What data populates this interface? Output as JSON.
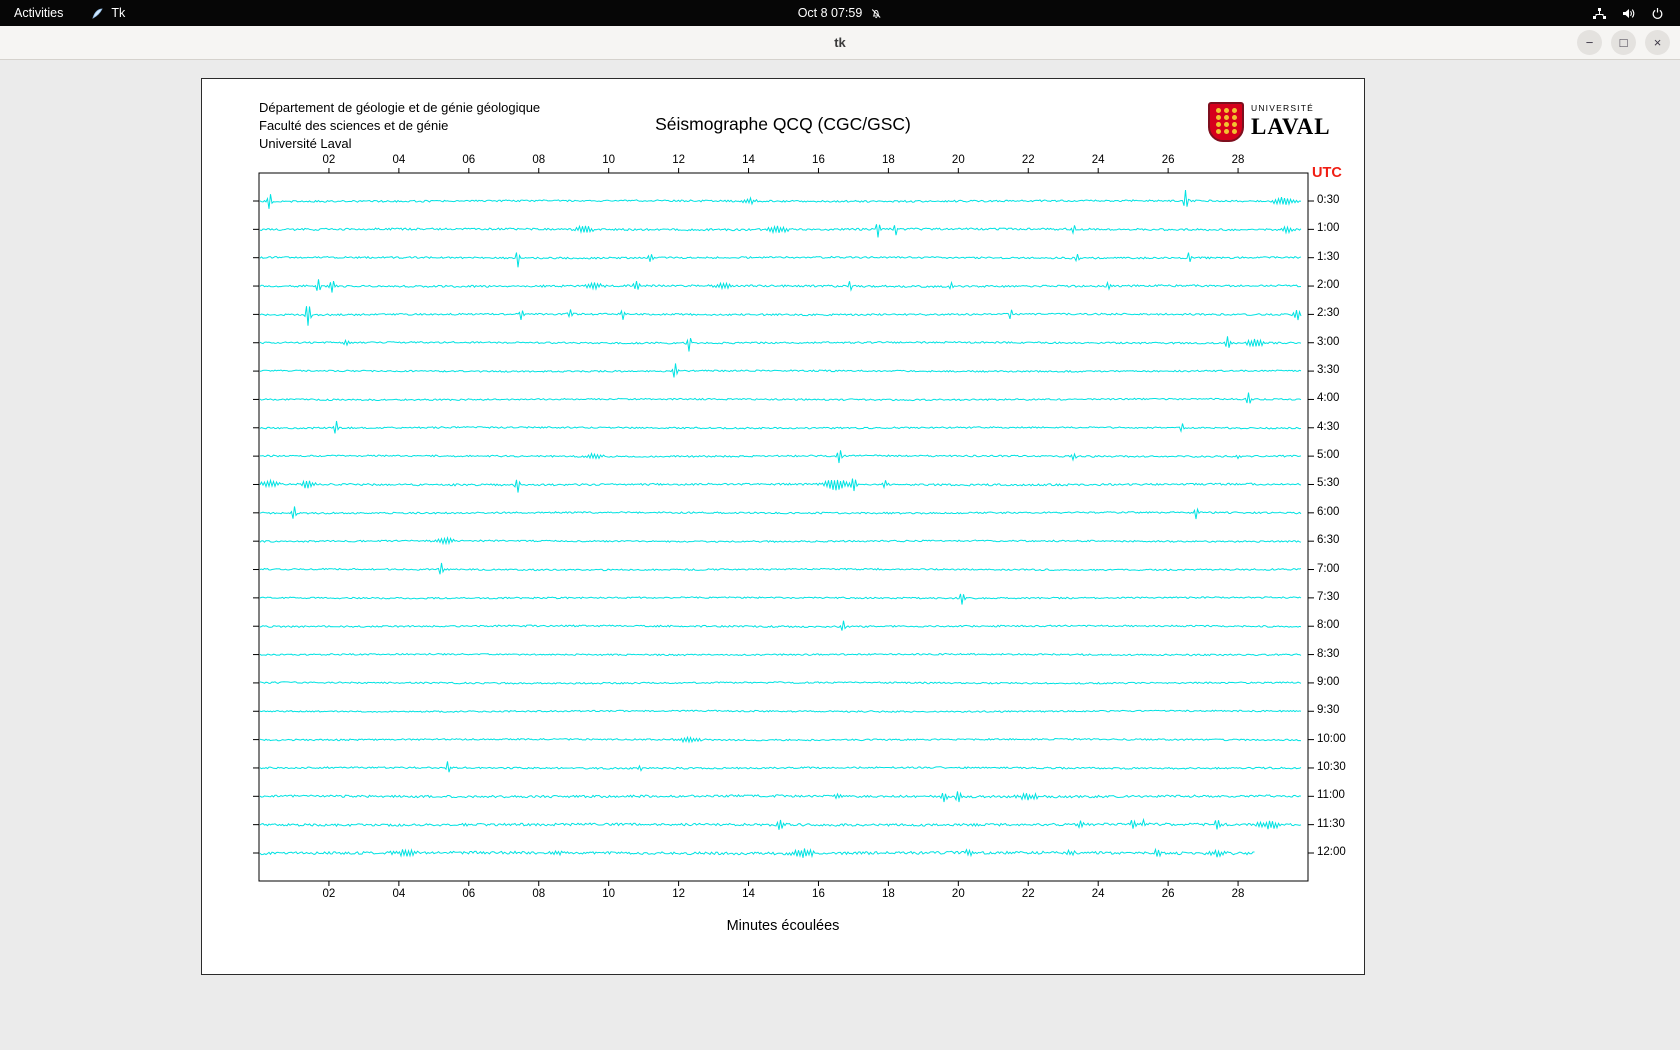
{
  "top_bar": {
    "activities_label": "Activities",
    "app_name": "Tk",
    "clock": "Oct 8  07:59",
    "icons": {
      "notification": "bell-slash-icon",
      "network": "network-icon",
      "volume": "volume-icon",
      "power": "power-icon"
    }
  },
  "window": {
    "title": "tk",
    "controls": {
      "minimize": "−",
      "maximize": "□",
      "close": "×"
    }
  },
  "seismograph": {
    "institution_lines": [
      "Département de géologie et de génie géologique",
      "Faculté des sciences et de génie",
      "Université Laval"
    ],
    "title": "Séismographe QCQ (CGC/GSC)",
    "utc_label": "UTC",
    "x_axis_label": "Minutes écoulées",
    "trace_color": "#00e2e2",
    "utc_color": "#f01e14",
    "logo": {
      "top_text": "UNIVERSITÉ",
      "bottom_text": "LAVAL",
      "shield_color": "#d6001c"
    }
  },
  "chart_data": {
    "type": "line",
    "x_range_minutes": [
      0,
      30
    ],
    "x_tick_minutes": [
      2,
      4,
      6,
      8,
      10,
      12,
      14,
      16,
      18,
      20,
      22,
      24,
      26,
      28
    ],
    "x_tick_labels": [
      "02",
      "04",
      "06",
      "08",
      "10",
      "12",
      "14",
      "16",
      "18",
      "20",
      "22",
      "24",
      "26",
      "28"
    ],
    "row_interval_minutes": 30,
    "default_end_minute": 29.8,
    "rows": [
      {
        "label": "0:30",
        "noise": 0.9,
        "spikes": [
          [
            0.3,
            9,
            0.05
          ],
          [
            14.0,
            2.5,
            0.2
          ],
          [
            26.5,
            10,
            0.05
          ],
          [
            29.3,
            3.5,
            0.3
          ]
        ]
      },
      {
        "label": "1:00",
        "noise": 1.0,
        "spikes": [
          [
            9.3,
            3,
            0.25
          ],
          [
            14.8,
            3,
            0.3
          ],
          [
            17.7,
            8,
            0.05
          ],
          [
            18.2,
            6,
            0.05
          ],
          [
            23.3,
            5,
            0.05
          ],
          [
            29.4,
            2.5,
            0.2
          ]
        ]
      },
      {
        "label": "1:30",
        "noise": 0.9,
        "spikes": [
          [
            7.4,
            9,
            0.05
          ],
          [
            11.2,
            4,
            0.08
          ],
          [
            23.4,
            4,
            0.06
          ],
          [
            26.6,
            5,
            0.05
          ]
        ]
      },
      {
        "label": "2:00",
        "noise": 1.0,
        "spikes": [
          [
            1.7,
            6,
            0.06
          ],
          [
            2.1,
            7,
            0.06
          ],
          [
            9.6,
            2.5,
            0.25
          ],
          [
            10.8,
            4,
            0.08
          ],
          [
            13.3,
            2.5,
            0.25
          ],
          [
            16.9,
            5,
            0.05
          ],
          [
            19.8,
            4.5,
            0.05
          ],
          [
            24.3,
            3.5,
            0.06
          ]
        ]
      },
      {
        "label": "2:30",
        "noise": 0.9,
        "spikes": [
          [
            1.4,
            11,
            0.07
          ],
          [
            7.5,
            5,
            0.06
          ],
          [
            8.9,
            4,
            0.06
          ],
          [
            10.4,
            5,
            0.05
          ],
          [
            21.5,
            6,
            0.05
          ],
          [
            29.7,
            4.5,
            0.1
          ]
        ]
      },
      {
        "label": "3:00",
        "noise": 0.85,
        "spikes": [
          [
            2.5,
            2.5,
            0.1
          ],
          [
            12.3,
            8,
            0.05
          ],
          [
            27.7,
            7,
            0.06
          ],
          [
            28.5,
            3.5,
            0.25
          ]
        ]
      },
      {
        "label": "3:30",
        "noise": 0.8,
        "spikes": [
          [
            11.9,
            8,
            0.06
          ]
        ]
      },
      {
        "label": "4:00",
        "noise": 0.8,
        "spikes": [
          [
            28.3,
            7,
            0.05
          ]
        ]
      },
      {
        "label": "4:30",
        "noise": 0.8,
        "spikes": [
          [
            2.2,
            7,
            0.05
          ],
          [
            26.4,
            4,
            0.05
          ]
        ]
      },
      {
        "label": "5:00",
        "noise": 0.85,
        "spikes": [
          [
            9.6,
            2.5,
            0.2
          ],
          [
            16.6,
            7,
            0.06
          ],
          [
            23.3,
            3.5,
            0.06
          ],
          [
            28.0,
            2.5,
            0.05
          ]
        ]
      },
      {
        "label": "5:30",
        "noise": 1.0,
        "spikes": [
          [
            0.3,
            3,
            0.25
          ],
          [
            1.4,
            3.5,
            0.2
          ],
          [
            7.4,
            7,
            0.06
          ],
          [
            16.5,
            5,
            0.3
          ],
          [
            17.0,
            7,
            0.08
          ],
          [
            17.9,
            4,
            0.06
          ]
        ]
      },
      {
        "label": "6:00",
        "noise": 0.85,
        "spikes": [
          [
            1.0,
            7,
            0.05
          ],
          [
            26.8,
            6,
            0.05
          ]
        ]
      },
      {
        "label": "6:30",
        "noise": 0.8,
        "spikes": [
          [
            5.3,
            3,
            0.25
          ]
        ]
      },
      {
        "label": "7:00",
        "noise": 0.8,
        "spikes": [
          [
            5.2,
            7,
            0.05
          ]
        ]
      },
      {
        "label": "7:30",
        "noise": 0.8,
        "spikes": [
          [
            20.1,
            7,
            0.06
          ]
        ]
      },
      {
        "label": "8:00",
        "noise": 0.85,
        "spikes": [
          [
            16.7,
            6,
            0.05
          ]
        ]
      },
      {
        "label": "8:30",
        "noise": 0.8,
        "spikes": []
      },
      {
        "label": "9:00",
        "noise": 0.8,
        "spikes": []
      },
      {
        "label": "9:30",
        "noise": 0.75,
        "spikes": []
      },
      {
        "label": "10:00",
        "noise": 0.8,
        "spikes": [
          [
            12.3,
            2.2,
            0.3
          ]
        ]
      },
      {
        "label": "10:30",
        "noise": 0.85,
        "spikes": [
          [
            5.4,
            6,
            0.05
          ],
          [
            10.9,
            3.5,
            0.06
          ]
        ]
      },
      {
        "label": "11:00",
        "noise": 1.15,
        "spikes": [
          [
            16.5,
            2.5,
            0.1
          ],
          [
            19.6,
            4.5,
            0.08
          ],
          [
            20.0,
            5,
            0.08
          ],
          [
            22.0,
            2.8,
            0.3
          ]
        ]
      },
      {
        "label": "11:30",
        "noise": 1.25,
        "spikes": [
          [
            14.9,
            4.5,
            0.1
          ],
          [
            23.5,
            3.5,
            0.1
          ],
          [
            25.0,
            4.5,
            0.08
          ],
          [
            25.3,
            3.5,
            0.06
          ],
          [
            27.4,
            4.5,
            0.08
          ],
          [
            28.9,
            3.5,
            0.3
          ]
        ]
      },
      {
        "label": "12:00",
        "end_minute": 28.5,
        "noise": 1.4,
        "spikes": [
          [
            4.2,
            2.6,
            0.3
          ],
          [
            8.5,
            2.2,
            0.2
          ],
          [
            15.6,
            3.5,
            0.3
          ],
          [
            20.3,
            3.5,
            0.08
          ],
          [
            23.2,
            2.6,
            0.1
          ],
          [
            25.7,
            2.6,
            0.15
          ],
          [
            27.4,
            2.6,
            0.2
          ]
        ]
      }
    ]
  }
}
